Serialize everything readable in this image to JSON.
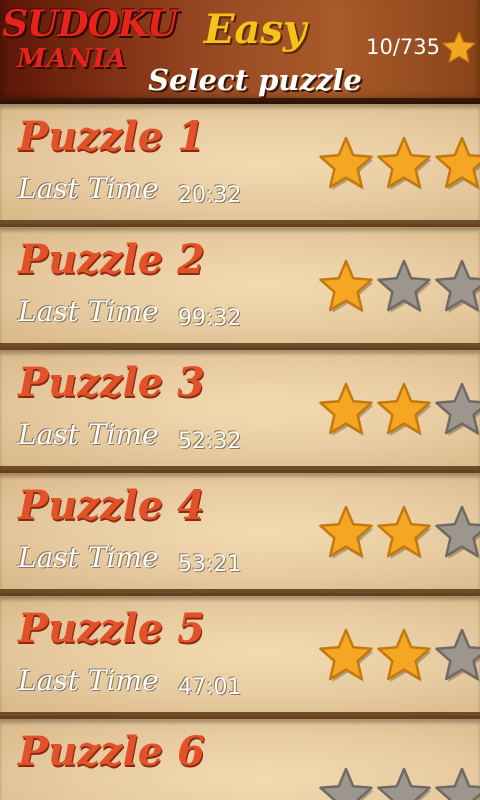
{
  "header": {
    "logo_top": "SUDOKU",
    "logo_bottom": "MANIA",
    "difficulty": "Easy",
    "subtitle": "Select puzzle",
    "stars_collected": "10/735",
    "star_icon": "star-icon"
  },
  "colors": {
    "star_gold": "#f5a623",
    "star_empty": "#9d968c",
    "title_red": "#e2522a",
    "header_gold": "#f5c418"
  },
  "puzzles": [
    {
      "title": "Puzzle 1",
      "last_time_label": "Last Time",
      "last_time": "20:32",
      "stars": 3
    },
    {
      "title": "Puzzle 2",
      "last_time_label": "Last Time",
      "last_time": "99:32",
      "stars": 1
    },
    {
      "title": "Puzzle 3",
      "last_time_label": "Last Time",
      "last_time": "52:32",
      "stars": 2
    },
    {
      "title": "Puzzle 4",
      "last_time_label": "Last Time",
      "last_time": "53:21",
      "stars": 2
    },
    {
      "title": "Puzzle 5",
      "last_time_label": "Last Time",
      "last_time": "47:01",
      "stars": 2
    },
    {
      "title": "Puzzle 6",
      "last_time_label": "",
      "last_time": "",
      "stars": 0
    }
  ]
}
